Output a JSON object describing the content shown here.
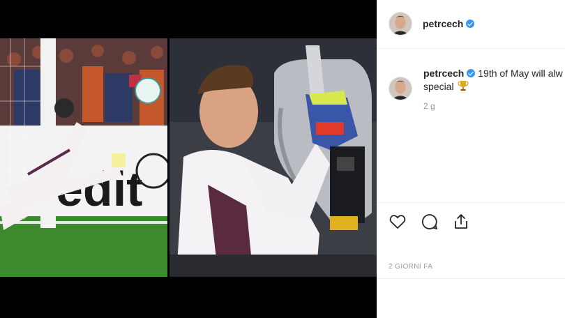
{
  "post": {
    "username": "petrcech",
    "caption": {
      "line1": "19th of May will alw",
      "line2": "special"
    },
    "comment_time": "2 g",
    "post_date": "2 GIORNI FA"
  },
  "icons": {
    "verified": "verified-badge-icon",
    "like": "heart-icon",
    "comment": "comment-icon",
    "share": "share-icon",
    "trophy": "trophy-icon"
  },
  "colors": {
    "verified": "#3897f0",
    "text": "#262626",
    "muted": "#999999",
    "divider": "#efefef"
  }
}
